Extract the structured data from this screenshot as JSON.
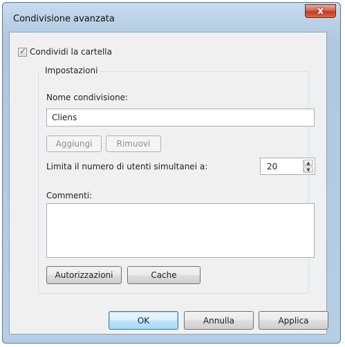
{
  "window": {
    "title": "Condivisione avanzata",
    "close_glyph": "x"
  },
  "share": {
    "checkbox_label": "Condividi la cartella",
    "checked": true
  },
  "settings": {
    "group_label": "Impostazioni",
    "name_label": "Nome condivisione:",
    "name_value": "Cliens",
    "add_label": "Aggiungi",
    "remove_label": "Rimuovi",
    "limit_label": "Limita il numero di utenti simultanei a:",
    "limit_value": "20",
    "comments_label": "Commenti:",
    "comments_value": "",
    "permissions_label": "Autorizzazioni",
    "cache_label": "Cache"
  },
  "footer": {
    "ok_label": "OK",
    "cancel_label": "Annulla",
    "apply_label": "Applica"
  },
  "icons": {
    "close": "close-icon",
    "check": "check-icon",
    "spin_up": "arrow-up-icon",
    "spin_down": "arrow-down-icon"
  }
}
